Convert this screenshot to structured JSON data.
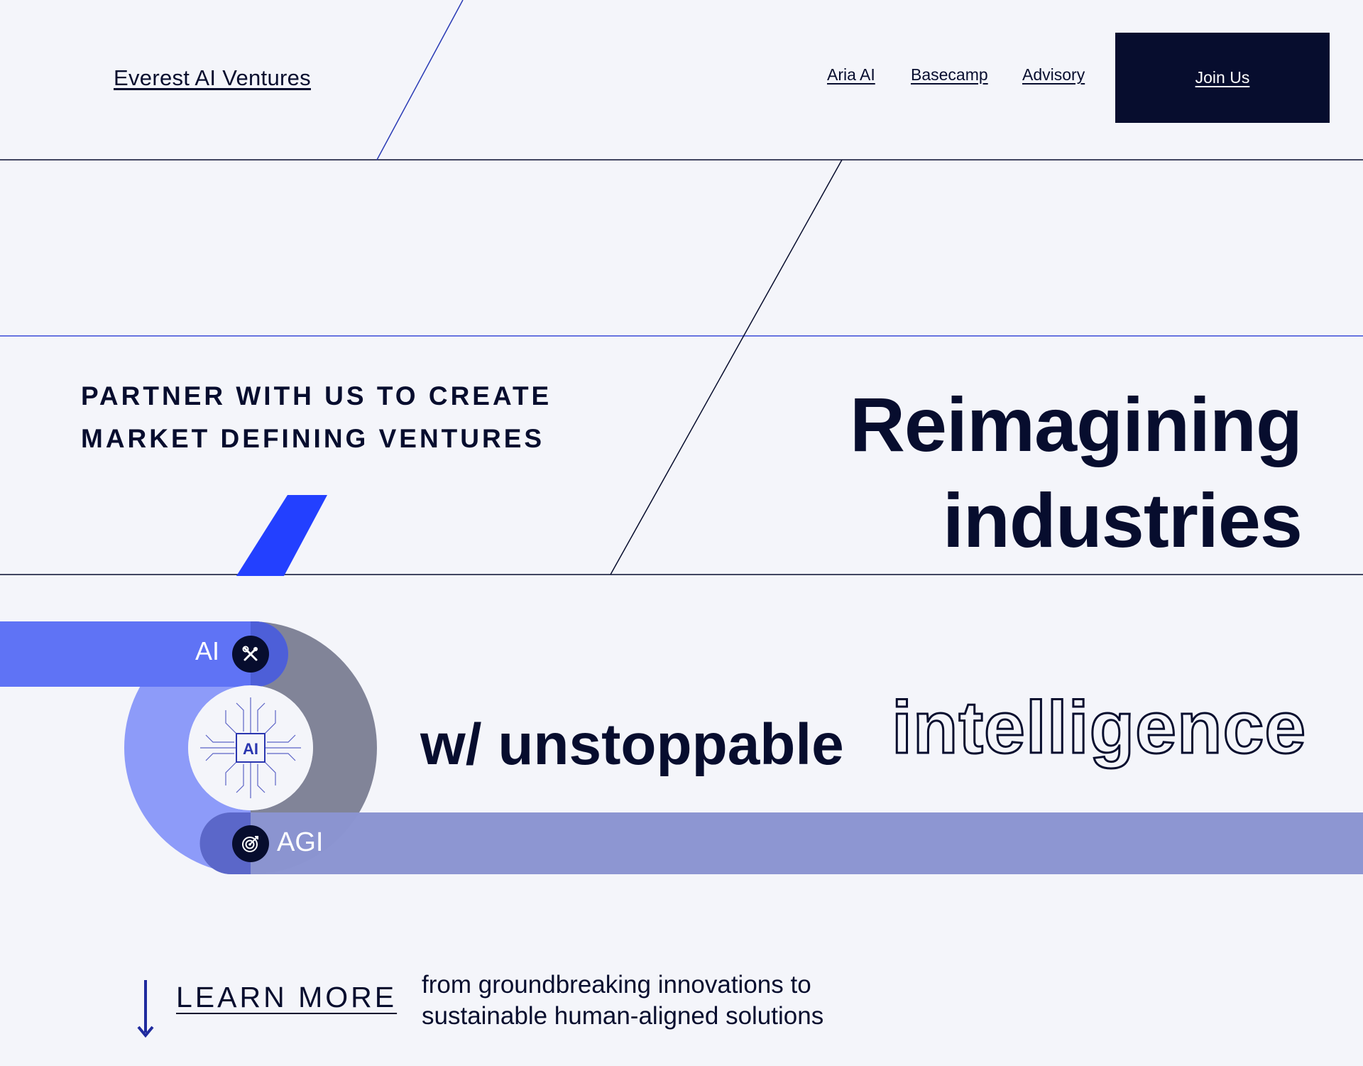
{
  "header": {
    "brand": "Everest AI Ventures",
    "nav": [
      "Aria AI",
      "Basecamp",
      "Advisory"
    ],
    "cta": "Join Us"
  },
  "hero": {
    "tagline_line1": "PARTNER WITH US TO CREATE",
    "tagline_line2": "MARKET DEFINING VENTURES",
    "headline_line1": "Reimagining",
    "headline_line2": "industries"
  },
  "slogan": {
    "bold": "w/ unstoppable",
    "outline": "intelligence"
  },
  "diagram": {
    "top_label": "AI",
    "top_icon": "tools-icon",
    "bottom_label": "AGI",
    "bottom_icon": "target-icon",
    "chip_label": "AI",
    "chip_icon": "ai-chip-icon"
  },
  "footer": {
    "learn_more": "LEARN MORE",
    "arrow_icon": "arrow-down-icon",
    "sub_line1": "from groundbreaking innovations to",
    "sub_line2": "sustainable human-aligned solutions"
  },
  "colors": {
    "background": "#f4f5fa",
    "navy": "#070d2e",
    "royal_blue": "#2340ff",
    "periwinkle": "#5f73f5",
    "lavender": "#8b94d1",
    "gray_arc": "#818498"
  }
}
